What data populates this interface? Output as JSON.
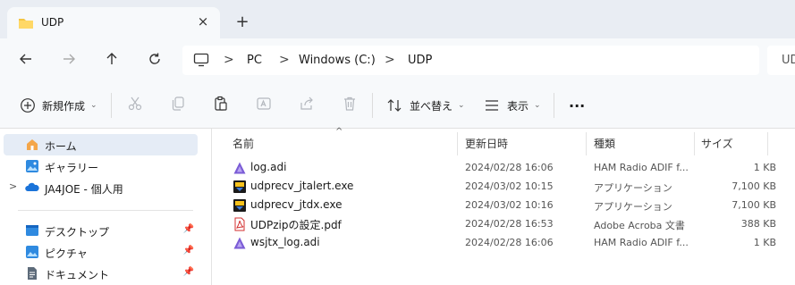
{
  "tab": {
    "title": "UDP",
    "close": "×",
    "new_tab": "+"
  },
  "address": {
    "crumbs": [
      "PC",
      "Windows (C:)",
      "UDP"
    ],
    "separator": ">",
    "search_placeholder": "UD"
  },
  "toolbar": {
    "new_label": "新規作成",
    "sort_label": "並べ替え",
    "view_label": "表示",
    "more_label": "..."
  },
  "sidebar": {
    "items": [
      {
        "label": "ホーム",
        "icon": "home-icon",
        "selected": true
      },
      {
        "label": "ギャラリー",
        "icon": "gallery-icon"
      },
      {
        "label": "JA4JOE - 個人用",
        "icon": "onedrive-icon",
        "expand": ">"
      },
      {
        "label": "デスクトップ",
        "icon": "desktop-icon",
        "pinned": true
      },
      {
        "label": "ピクチャ",
        "icon": "pictures-icon",
        "pinned": true
      },
      {
        "label": "ドキュメント",
        "icon": "documents-icon",
        "pinned": true
      }
    ]
  },
  "columns": {
    "name": "名前",
    "modified": "更新日時",
    "type": "種類",
    "size": "サイズ"
  },
  "files": [
    {
      "name": "log.adi",
      "modified": "2024/02/28 16:06",
      "type": "HAM Radio ADIF f...",
      "size": "1 KB",
      "icon": "adif-file-icon"
    },
    {
      "name": "udprecv_jtalert.exe",
      "modified": "2024/03/02 10:15",
      "type": "アプリケーション",
      "size": "7,100 KB",
      "icon": "exe-file-icon"
    },
    {
      "name": "udprecv_jtdx.exe",
      "modified": "2024/03/02 10:16",
      "type": "アプリケーション",
      "size": "7,100 KB",
      "icon": "exe-file-icon"
    },
    {
      "name": "UDPzipの設定.pdf",
      "modified": "2024/02/28 16:53",
      "type": "Adobe Acroba 文書",
      "size": "388 KB",
      "icon": "pdf-file-icon"
    },
    {
      "name": "wsjtx_log.adi",
      "modified": "2024/02/28 16:06",
      "type": "HAM Radio ADIF f...",
      "size": "1 KB",
      "icon": "adif-file-icon"
    }
  ],
  "colors": {
    "accent": "#005fb8",
    "selected_bg": "#e5ecf6",
    "adif_purple": "#7b5cd6",
    "pdf_red": "#d32f2f",
    "folder_yellow": "#f4c542"
  }
}
